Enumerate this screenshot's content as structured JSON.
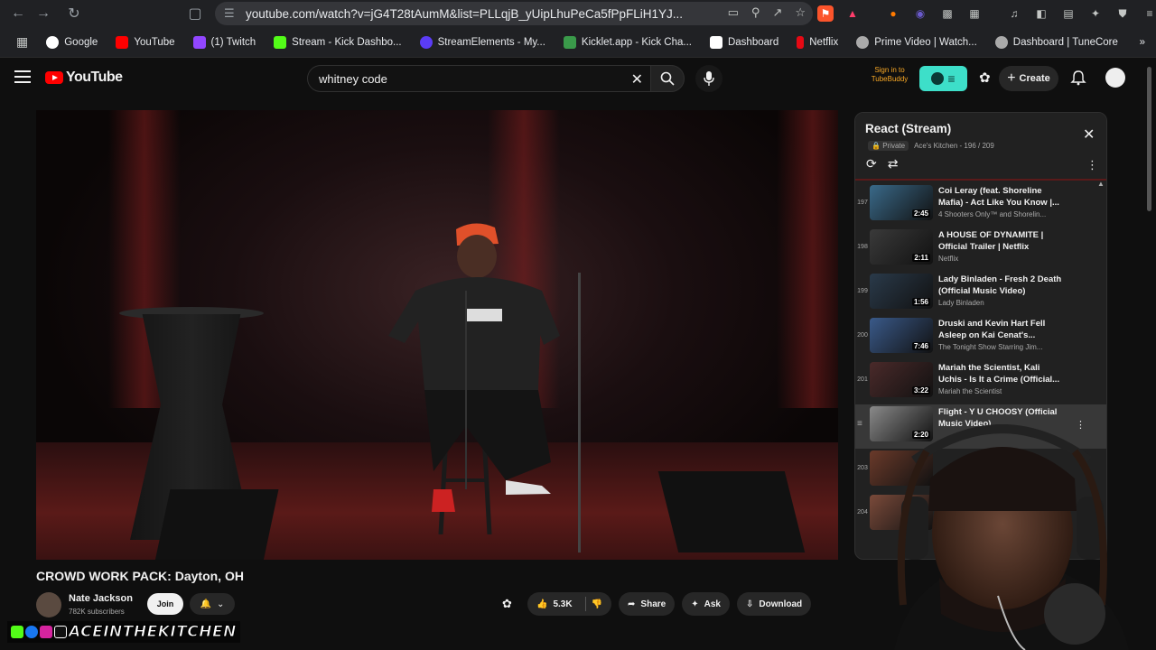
{
  "browser": {
    "url": "youtube.com/watch?v=jG4T28tAumM&list=PLLqjB_yUipLhuPeCa5fPpFLiH1YJ...",
    "bookmarks": [
      {
        "label": "Google",
        "color": "#ffffff"
      },
      {
        "label": "YouTube",
        "color": "#ff0000"
      },
      {
        "label": "(1) Twitch",
        "color": "#9146ff"
      },
      {
        "label": "Stream - Kick Dashbo...",
        "color": "#53fc18"
      },
      {
        "label": "StreamElements - My...",
        "color": "#5b3cf5"
      },
      {
        "label": "Kicklet.app - Kick Cha...",
        "color": "#3a9a4a"
      },
      {
        "label": "Dashboard",
        "color": "#ffffff"
      },
      {
        "label": "Netflix",
        "color": "#e50914"
      },
      {
        "label": "Prime Video | Watch...",
        "color": "#aaaaaa"
      },
      {
        "label": "Dashboard | TuneCore",
        "color": "#aaaaaa"
      }
    ]
  },
  "header": {
    "logo": "YouTube",
    "search_value": "whitney code",
    "tubebuddy_signin": "Sign in to TubeBuddy",
    "create_label": "Create"
  },
  "video": {
    "title": "CROWD WORK PACK: Dayton, OH",
    "channel": "Nate Jackson",
    "subscribers": "782K subscribers",
    "join_label": "Join",
    "likes": "5.3K",
    "share_label": "Share",
    "ask_label": "Ask",
    "download_label": "Download"
  },
  "playlist": {
    "title": "React (Stream)",
    "privacy": "Private",
    "meta": "Ace's Kitchen - 196 / 209",
    "items": [
      {
        "index": "197",
        "title": "Coi Leray (feat. Shoreline Mafia) - Act Like You Know |...",
        "channel": "4 Shooters Only™ and Shorelin...",
        "duration": "2:45",
        "thumb": "#3a6a8a",
        "active": false
      },
      {
        "index": "198",
        "title": "A HOUSE OF DYNAMITE | Official Trailer | Netflix",
        "channel": "Netflix",
        "duration": "2:11",
        "thumb": "#3a3a3a",
        "active": false
      },
      {
        "index": "199",
        "title": "Lady Binladen - Fresh 2 Death (Official Music Video)",
        "channel": "Lady Binladen",
        "duration": "1:56",
        "thumb": "#2a3a4a",
        "active": false
      },
      {
        "index": "200",
        "title": "Druski and Kevin Hart Fell Asleep on Kai Cenat's...",
        "channel": "The Tonight Show Starring Jim...",
        "duration": "7:46",
        "thumb": "#3a5a8a",
        "active": false
      },
      {
        "index": "201",
        "title": "Mariah the Scientist, Kali Uchis - Is It a Crime (Official...",
        "channel": "Mariah the Scientist",
        "duration": "3:22",
        "thumb": "#4a2a2a",
        "active": false
      },
      {
        "index": "",
        "title": "Flight - Y U CHOOSY (Official Music Video)",
        "channel": "",
        "duration": "2:20",
        "thumb": "#8a8a8a",
        "active": true
      },
      {
        "index": "203",
        "title": "",
        "channel": "",
        "duration": "",
        "thumb": "#6a3a2a",
        "active": false
      },
      {
        "index": "204",
        "title": "",
        "channel": "",
        "duration": "",
        "thumb": "#7a4a3a",
        "active": false
      }
    ]
  },
  "watermark": "ACEINTHEKITCHEN",
  "colors": {
    "background": "#0f0f0f",
    "accent_red": "#ff0000",
    "tubebuddy": "#3ddfc9"
  }
}
